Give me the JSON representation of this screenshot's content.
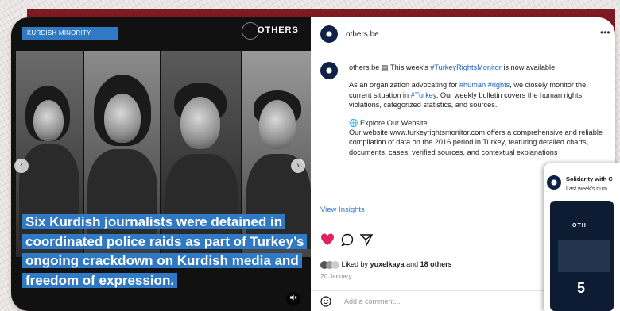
{
  "media": {
    "tag": "KURDISH MINORITY",
    "brand": "OTHERS",
    "headline": "Six Kurdish journalists were detained in coordinated police raids as part of Turkey’s ongoing crackdown on Kurdish media and freedom of expression."
  },
  "post": {
    "username": "others.be",
    "menu_icon": "more-icon",
    "caption_user": "others.be",
    "caption_intro": "This week's",
    "caption_tag": "#TurkeyRightsMonitor",
    "caption_intro_end": "is now available!",
    "para1_a": "As an organization advocating for",
    "para1_tag1": "#human",
    "para1_tag2": "#rights",
    "para1_b": ", we closely monitor the current situation in",
    "para1_tag3": "#Turkey",
    "para1_c": ". Our weekly bulletin covers the human rights violations, categorized statistics, and sources.",
    "explore": "Explore Our Website",
    "para2": "Our website www.turkeyrightsmonitor.com offers a comprehensive and reliable compilation of data on the 2016 period in Turkey, featuring detailed charts, documents, cases, verified sources, and contextual explanations",
    "view_insights": "View Insights",
    "liked_prefix": "Liked by",
    "liked_user": "yuxelkaya",
    "liked_and": "and",
    "liked_count": "18 others",
    "date": "20 January",
    "comment_placeholder": "Add a comment..."
  },
  "second_post": {
    "title": "Solidarity with C",
    "text": "Last week's num",
    "brand": "OTH",
    "number": "5"
  },
  "colors": {
    "accent": "#2f79c5",
    "brand_navy": "#0f2245",
    "heart": "#e0245e",
    "frame_red": "#7e1b22"
  }
}
